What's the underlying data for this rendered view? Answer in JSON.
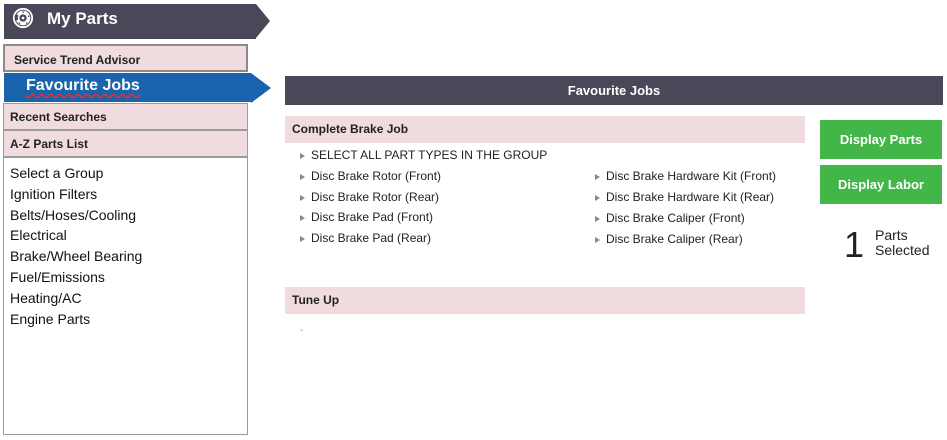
{
  "header": {
    "title": "My Parts",
    "logo_icon": "brake-disc-icon"
  },
  "sidebar": {
    "service_trend_advisor": "Service Trend Advisor",
    "favourite_jobs": "Favourite Jobs",
    "recent_searches": "Recent Searches",
    "az_parts_list": "A-Z Parts List",
    "groups": [
      "Select a Group",
      "Ignition Filters",
      "Belts/Hoses/Cooling",
      "Electrical",
      "Brake/Wheel Bearing",
      "Fuel/Emissions",
      "Heating/AC",
      "Engine Parts"
    ]
  },
  "main": {
    "title": "Favourite Jobs",
    "jobs": [
      {
        "name": "Complete Brake Job",
        "select_all": "SELECT ALL PART TYPES IN THE GROUP",
        "parts_left": [
          "Disc Brake Rotor (Front)",
          "Disc Brake Rotor (Rear)",
          "Disc Brake Pad (Front)",
          "Disc Brake Pad (Rear)"
        ],
        "parts_right": [
          "Disc Brake Hardware Kit (Front)",
          "Disc Brake Hardware Kit (Rear)",
          "Disc Brake Caliper (Front)",
          "Disc Brake Caliper (Rear)"
        ]
      },
      {
        "name": "Tune Up",
        "placeholder": "-"
      }
    ]
  },
  "actions": {
    "display_parts": "Display Parts",
    "display_labor": "Display Labor",
    "parts_selected_count": "1",
    "parts_label_1": "Parts",
    "parts_label_2": "Selected"
  },
  "colors": {
    "header_bg": "#4a4858",
    "active_tab": "#1a63ad",
    "menu_bg": "#f0dcdf",
    "button_green": "#43b649"
  }
}
